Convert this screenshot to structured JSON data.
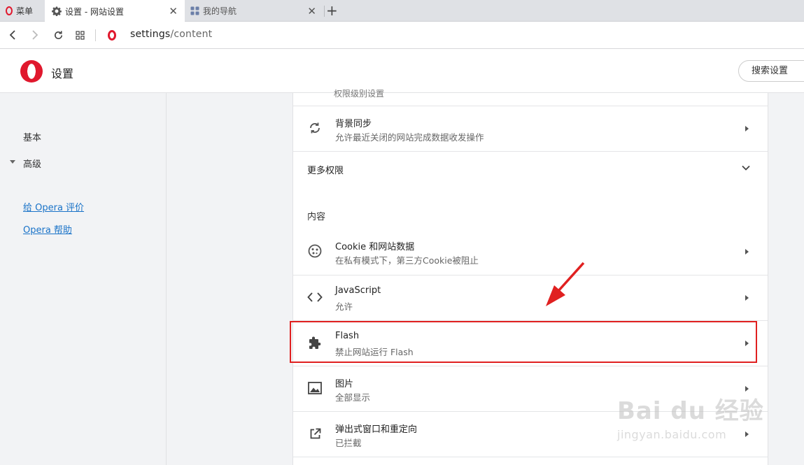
{
  "tabs": {
    "menu_label": "菜单",
    "active_title": "设置 - 网站设置",
    "inactive_title": "我的导航",
    "close_glyph": "✕",
    "newtab_glyph": "+"
  },
  "toolbar": {
    "url_host": "settings",
    "url_path": "/content"
  },
  "header": {
    "title": "设置",
    "search_button": "搜索设置"
  },
  "sidebar": {
    "basic": "基本",
    "advanced": "高级",
    "rate_link": "给 Opera 评价",
    "help_link": "Opera 帮助"
  },
  "content": {
    "cut_text": "权限级别设置",
    "rows_top": [
      {
        "icon": "sync-icon",
        "title": "背景同步",
        "subtitle": "允许最近关闭的网站完成数据收发操作"
      }
    ],
    "more_permissions": "更多权限",
    "section_label": "内容",
    "rows": [
      {
        "icon": "cookie-icon",
        "title": "Cookie 和网站数据",
        "subtitle": "在私有模式下，第三方Cookie被阻止"
      },
      {
        "icon": "code-icon",
        "title": "JavaScript",
        "subtitle": "允许"
      },
      {
        "icon": "puzzle-icon",
        "title": "Flash",
        "subtitle": "禁止网站运行 Flash"
      },
      {
        "icon": "image-icon",
        "title": "图片",
        "subtitle": "全部显示"
      },
      {
        "icon": "open-external-icon",
        "title": "弹出式窗口和重定向",
        "subtitle": "已拦截"
      }
    ]
  },
  "annotation": {
    "color": "#e02020"
  },
  "watermark": {
    "main": "Bai du 经验",
    "sub": "jingyan.baidu.com"
  },
  "colors": {
    "opera_red": "#e0182d",
    "link": "#1a73c8"
  }
}
